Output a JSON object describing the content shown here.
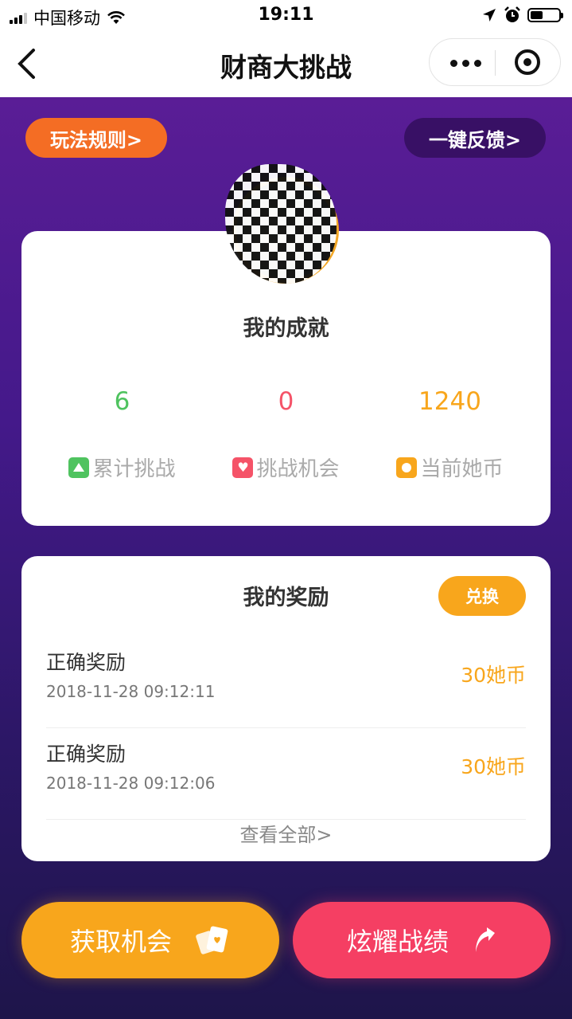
{
  "status_bar": {
    "carrier": "中国移动",
    "time": "19:11",
    "battery_level": 0.45
  },
  "nav": {
    "title": "财商大挑战"
  },
  "header_buttons": {
    "rules": "玩法规则>",
    "feedback": "一键反馈>"
  },
  "achievements": {
    "title": "我的成就",
    "stats": [
      {
        "value": "6",
        "label": "累计挑战",
        "color": "#4fc35f",
        "icon": "triangle-icon"
      },
      {
        "value": "0",
        "label": "挑战机会",
        "color": "#f55368",
        "icon": "heart-icon"
      },
      {
        "value": "1240",
        "label": "当前她币",
        "color": "#f8a61c",
        "icon": "coin-icon"
      }
    ]
  },
  "rewards": {
    "title": "我的奖励",
    "exchange_label": "兑换",
    "items": [
      {
        "name": "正确奖励",
        "date": "2018-11-28 09:12:11",
        "amount": "30她币"
      },
      {
        "name": "正确奖励",
        "date": "2018-11-28 09:12:06",
        "amount": "30她币"
      }
    ],
    "view_all": "查看全部>"
  },
  "actions": {
    "get_chance": "获取机会",
    "show_off": "炫耀战绩"
  },
  "colors": {
    "accent_orange": "#f8a61c",
    "accent_pink": "#f53f63",
    "bg_top": "#5a1d96",
    "bg_bottom": "#1e154a"
  }
}
